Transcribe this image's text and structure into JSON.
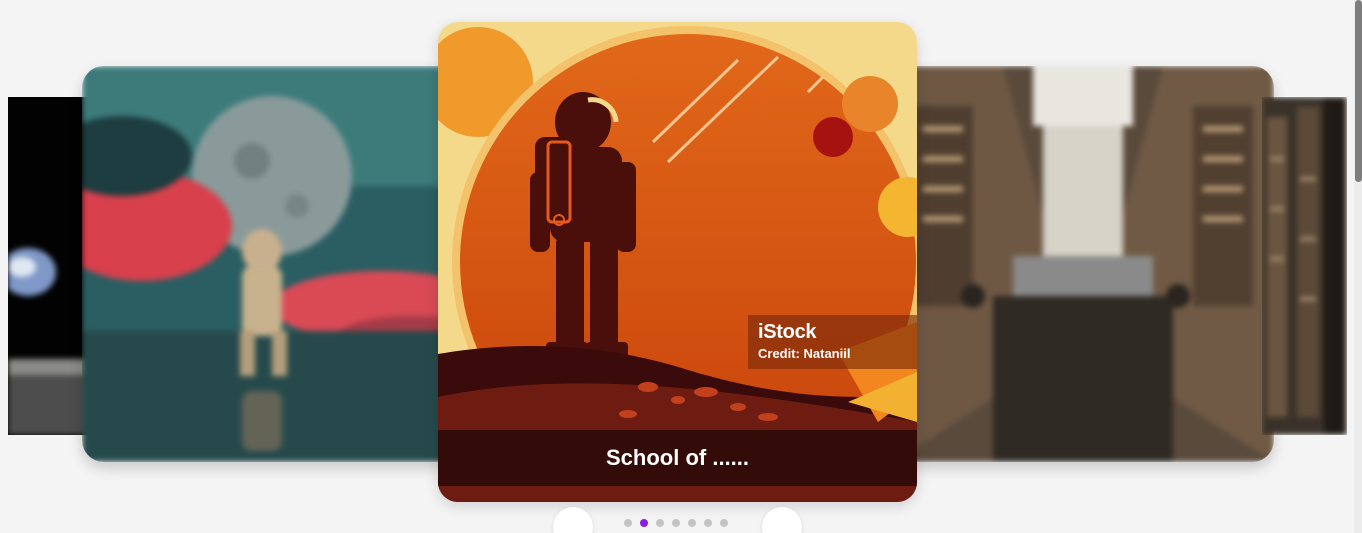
{
  "carousel": {
    "active_index": 1,
    "dot_count": 7,
    "center_caption": "School of ......",
    "credit_logo": "iStock",
    "credit_text": "Credit: Nataniil",
    "slides": [
      {
        "name": "earth-over-moon"
      },
      {
        "name": "astronaut-in-clouds"
      },
      {
        "name": "astronaut-on-mars-illustration"
      },
      {
        "name": "library-hall"
      },
      {
        "name": "library-shelves"
      }
    ]
  },
  "colors": {
    "accent": "#8a1de0",
    "dot_inactive": "#c4c4c4",
    "background": "#f4f4f4"
  }
}
